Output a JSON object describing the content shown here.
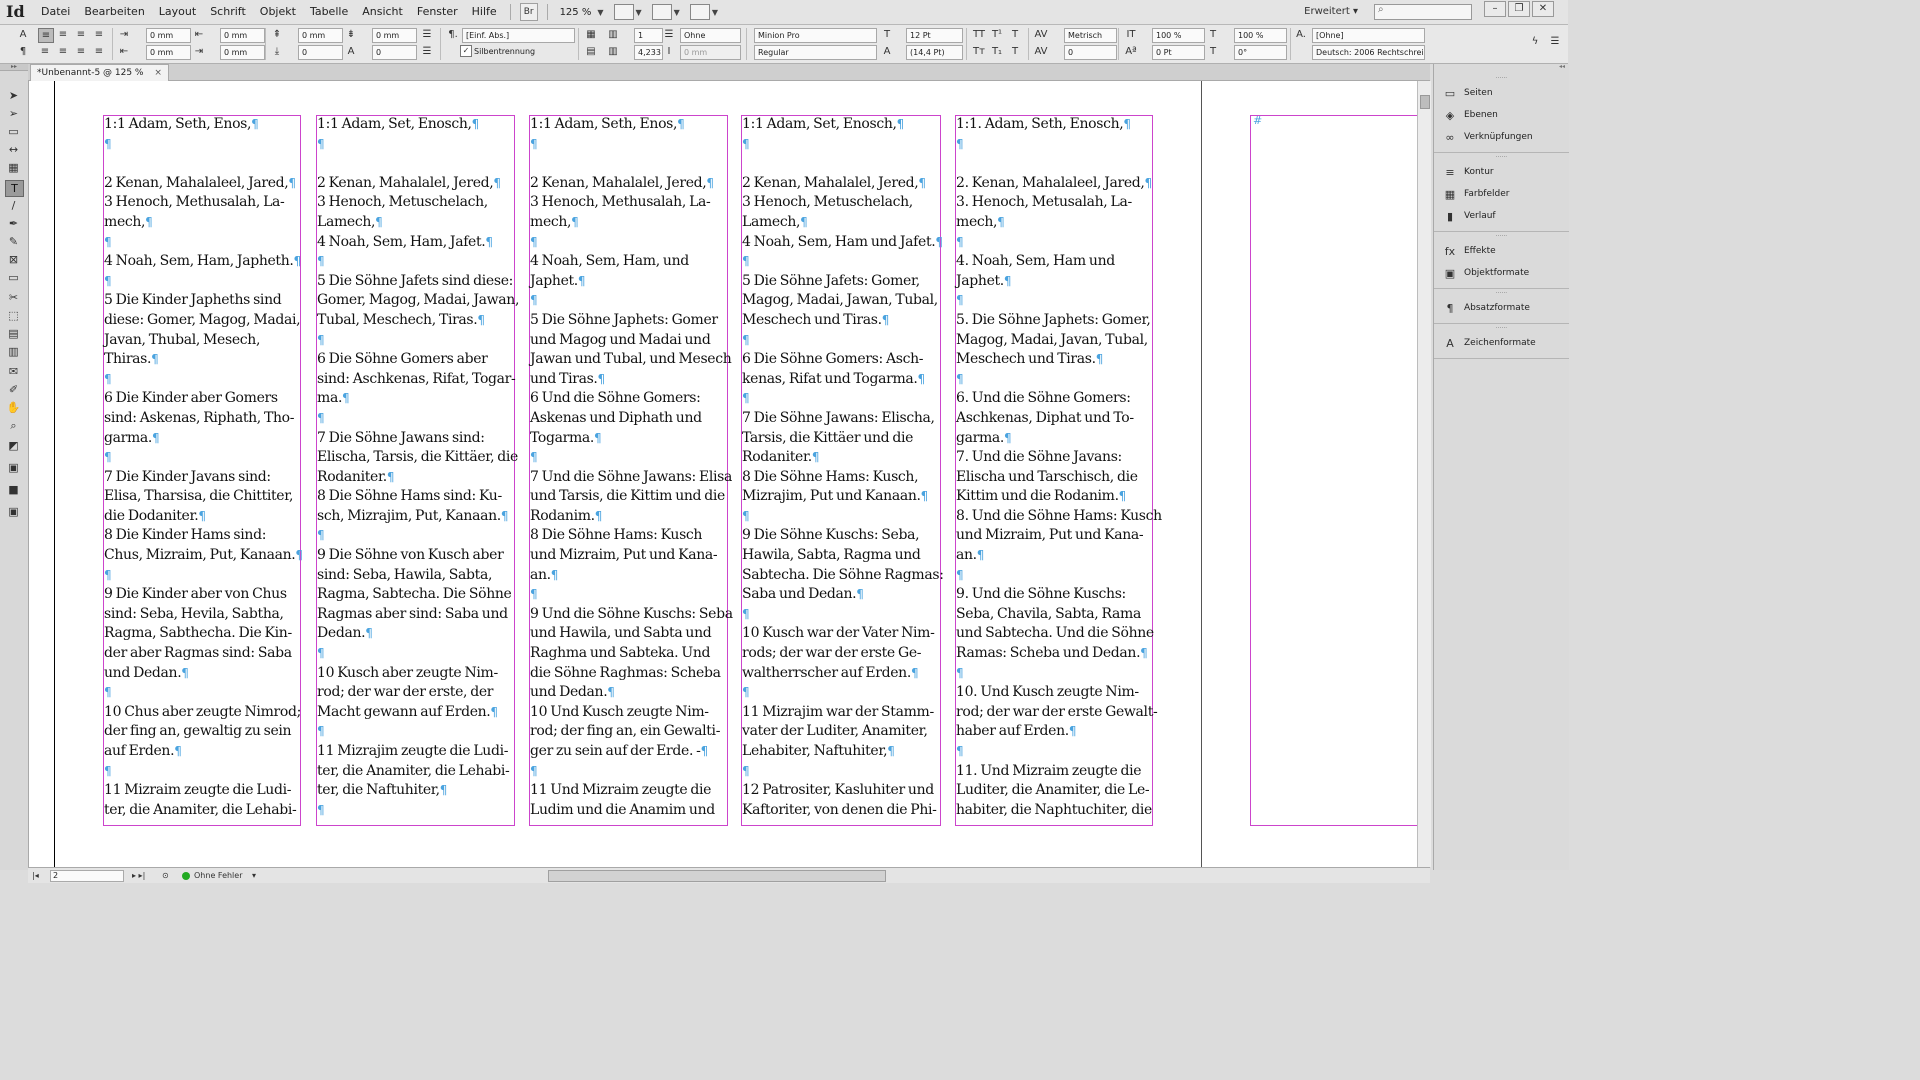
{
  "app": {
    "logo": "Id",
    "workspace": "Erweitert",
    "zoom": "125 %",
    "bridge_label": "Br"
  },
  "menus": [
    "Datei",
    "Bearbeiten",
    "Layout",
    "Schrift",
    "Objekt",
    "Tabelle",
    "Ansicht",
    "Fenster",
    "Hilfe"
  ],
  "window_controls": {
    "minimize": "–",
    "restore": "❐",
    "close": "✕"
  },
  "control_panel": {
    "indent_left": "0 mm",
    "indent_first": "0 mm",
    "indent_right": "0 mm",
    "indent_last": "0 mm",
    "space_before": "0 mm",
    "space_after": "0 mm",
    "drop_cap_lines": "0",
    "drop_cap_chars": "0",
    "paragraph_style": "[Einf. Abs.]",
    "hyphenation_label": "Silbentrennung",
    "hyphenation_checked": true,
    "columns": "1",
    "column_gutter": "4,233",
    "span": "Ohne",
    "span_width": "0 mm",
    "font_family": "Minion Pro",
    "font_style": "Regular",
    "font_size": "12 Pt",
    "leading": "(14,4 Pt)",
    "kerning": "Metrisch",
    "tracking": "0",
    "vertical_scale": "100 %",
    "horizontal_scale": "100 %",
    "baseline_shift": "0 Pt",
    "skew": "0°",
    "char_style": "[Ohne]",
    "language": "Deutsch: 2006 Rechtschreib"
  },
  "document_tab": {
    "title": "*Unbenannt-5 @ 125 %",
    "close": "×"
  },
  "columns": [
    [
      "1:1 Adam, Seth, Enos,¶",
      "¶",
      "",
      "2 Kenan, Mahalaleel, Jared,¶",
      "3 Henoch, Methusalah, La-",
      "mech,¶",
      "¶",
      "4 Noah, Sem, Ham, Japheth.¶",
      "¶",
      "5 Die Kinder Japheths sind",
      "diese: Gomer, Magog, Madai,",
      "Javan, Thubal, Mesech,",
      "Thiras.¶",
      "¶",
      "6 Die Kinder aber Gomers",
      "sind: Askenas, Riphath, Tho-",
      "garma.¶",
      "¶",
      "7 Die Kinder Javans sind:",
      "Elisa, Tharsisa, die Chittiter,",
      "die Dodaniter.¶",
      "8 Die Kinder Hams sind:",
      "Chus, Mizraim, Put, Kanaan.¶",
      "¶",
      "9 Die Kinder aber von Chus",
      "sind: Seba, Hevila, Sabtha,",
      "Ragma, Sabthecha. Die Kin-",
      "der aber Ragmas sind: Saba",
      "und Dedan.¶",
      "¶",
      "10 Chus aber zeugte Nimrod;",
      "der fing an, gewaltig zu sein",
      "auf Erden.¶",
      "¶",
      "11 Mizraim zeugte die Ludi-",
      "ter, die Anamiter, die Lehabi-"
    ],
    [
      "1:1 Adam, Set, Enosch,¶",
      "¶",
      "",
      "2 Kenan, Mahalalel, Jered,¶",
      "3 Henoch, Metuschelach,",
      "Lamech,¶",
      "4 Noah, Sem, Ham, Jafet.¶",
      "¶",
      "5  Die Söhne Jafets sind diese:",
      "Gomer, Magog, Madai, Jawan,",
      "Tubal, Meschech, Tiras.¶",
      "¶",
      "6 Die Söhne Gomers aber",
      "sind: Aschkenas, Rifat, Togar-",
      "ma.¶",
      "¶",
      "7 Die Söhne Jawans sind:",
      "Elischa, Tarsis, die Kittäer, die",
      "Rodaniter.¶",
      "8  Die Söhne Hams sind: Ku-",
      "sch, Mizrajim, Put, Kanaan.¶",
      "¶",
      "9 Die Söhne von Kusch aber",
      "sind: Seba, Hawila, Sabta,",
      "Ragma, Sabtecha. Die Söhne",
      "Ragmas aber sind: Saba und",
      "Dedan.¶",
      "¶",
      "10 Kusch aber zeugte Nim-",
      "rod; der war der erste, der",
      "Macht gewann auf Erden.¶",
      "¶",
      "11 Mizrajim zeugte die Ludi-",
      "ter, die Anamiter, die Lehabi-",
      "ter, die Naftuhiter,¶",
      "¶"
    ],
    [
      "1:1 Adam, Seth, Enos,¶",
      "¶",
      "",
      "2 Kenan, Mahalalel, Jered,¶",
      "3 Henoch, Methusalah, La-",
      "mech,¶",
      "¶",
      "4 Noah, Sem, Ham, und",
      "Japhet.¶",
      "¶",
      "5 Die Söhne Japhets: Gomer",
      "und Magog und Madai und",
      "Jawan und Tubal, und Mesech",
      "und Tiras.¶",
      "6 Und die Söhne Gomers:",
      "Askenas und Diphath und",
      "Togarma.¶",
      "¶",
      "7 Und die Söhne Jawans: Elisa",
      "und Tarsis, die Kittim und die",
      "Rodanim.¶",
      "8 Die Söhne Hams: Kusch",
      "und Mizraim, Put und Kana-",
      "an.¶",
      "¶",
      "9 Und die Söhne Kuschs: Seba",
      "und Hawila, und Sabta und",
      "Raghma und Sabteka. Und",
      "die Söhne Raghmas: Scheba",
      "und Dedan.¶",
      "10 Und Kusch zeugte Nim-",
      "rod; der fing an, ein Gewalti-",
      "ger zu sein auf der Erde. -¶",
      "¶",
      "11 Und Mizraim zeugte die",
      "Ludim und die Anamim und"
    ],
    [
      "1:1 Adam, Set, Enosch,¶",
      "¶",
      "",
      "2 Kenan, Mahalalel, Jered,¶",
      "3 Henoch, Metuschelach,",
      "Lamech,¶",
      "4 Noah, Sem, Ham und Jafet.¶",
      "¶",
      "5 Die Söhne Jafets: Gomer,",
      "Magog, Madai, Jawan, Tubal,",
      "Meschech und Tiras.¶",
      "¶",
      "6 Die Söhne Gomers: Asch-",
      "kenas, Rifat und Togarma.¶",
      "¶",
      "7 Die Söhne Jawans: Elischa,",
      "Tarsis, die Kittäer und die",
      "Rodaniter.¶",
      "8 Die Söhne Hams: Kusch,",
      "Mizrajim, Put und Kanaan.¶",
      "¶",
      "9 Die Söhne Kuschs: Seba,",
      "Hawila, Sabta, Ragma und",
      "Sabtecha. Die Söhne Ragmas:",
      "Saba und Dedan.¶",
      "¶",
      "10 Kusch war der Vater Nim-",
      "rods; der war der erste Ge-",
      "waltherrscher auf Erden.¶",
      "¶",
      "11 Mizrajim war der Stamm-",
      "vater der Luditer, Anamiter,",
      "Lehabiter, Naftuhiter,¶",
      "¶",
      "12 Patrositer, Kasluhiter und",
      "Kaftoriter, von denen die Phi-"
    ],
    [
      "1:1. Adam, Seth, Enosch,¶",
      "¶",
      "",
      "2. Kenan, Mahalaleel, Jared,¶",
      "3. Henoch, Metusalah, La-",
      "mech,¶",
      "¶",
      "4. Noah, Sem, Ham und",
      "Japhet.¶",
      "¶",
      "5. Die Söhne Japhets: Gomer,",
      "Magog, Madai, Javan, Tubal,",
      "Meschech und Tiras.¶",
      "¶",
      "6. Und die Söhne Gomers:",
      "Aschkenas, Diphat und To-",
      "garma.¶",
      "7. Und die Söhne Javans:",
      "Elischa und Tarschisch, die",
      "Kittim und die Rodanim.¶",
      "8. Und die Söhne Hams: Kusch",
      "und Mizraim, Put und Kana-",
      "an.¶",
      "¶",
      "9. Und die Söhne Kuschs:",
      "Seba, Chavila, Sabta, Rama",
      "und Sabtecha. Und die Söhne",
      "Ramas: Scheba und Dedan.¶",
      "¶",
      "10. Und Kusch zeugte Nim-",
      "rod; der war der erste Gewalt-",
      "haber auf Erden.¶",
      "¶",
      "11. Und Mizraim zeugte die",
      "Luditer, die Anamiter, die Le-",
      "habiter, die Naphtuchiter, die"
    ]
  ],
  "next_frame_marker": "#",
  "panels": [
    [
      "Seiten",
      "Ebenen",
      "Verknüpfungen"
    ],
    [
      "Kontur",
      "Farbfelder",
      "Verlauf"
    ],
    [
      "Effekte",
      "Objektformate"
    ],
    [
      "Absatzformate"
    ],
    [
      "Zeichenformate"
    ]
  ],
  "status": {
    "page": "2",
    "preflight": "Ohne Fehler"
  }
}
